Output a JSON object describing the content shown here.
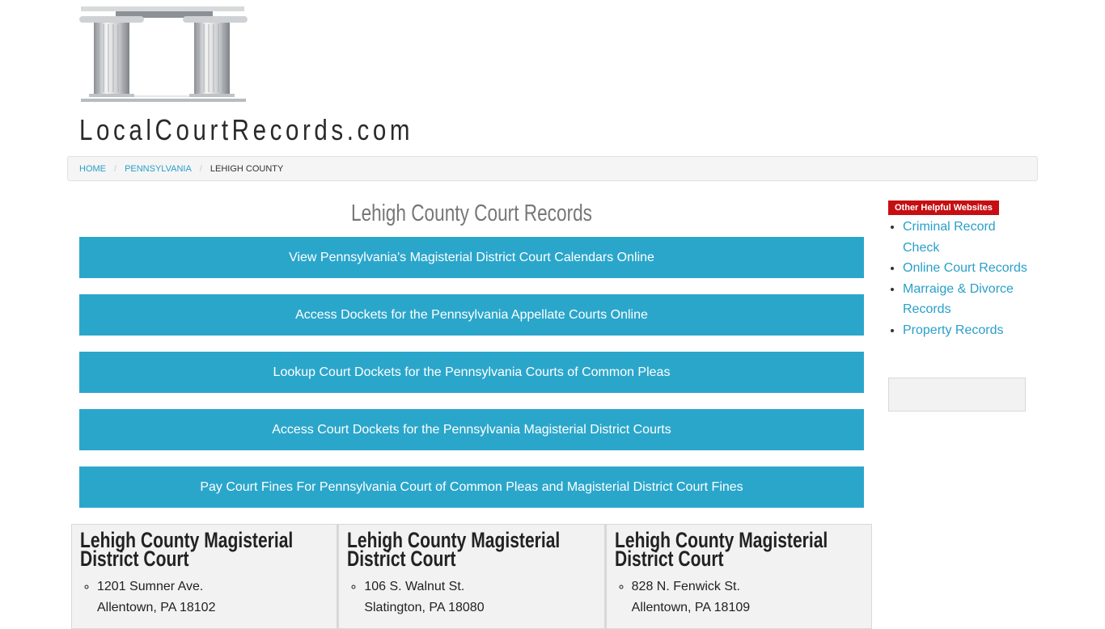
{
  "site": {
    "name": "LocalCourtRecords.com",
    "logo_alt": "courthouse-pillars-logo"
  },
  "breadcrumb": [
    {
      "label": "Home"
    },
    {
      "label": "Pennsylvania"
    },
    {
      "label": "Lehigh County"
    }
  ],
  "main": {
    "title": "Lehigh County Court Records",
    "buttons": [
      {
        "label": "View Pennsylvania's Magisterial District Court Calendars Online"
      },
      {
        "label": "Access Dockets for the Pennsylvania Appellate Courts Online"
      },
      {
        "label": "Lookup Court Dockets for the Pennsylvania Courts of Common Pleas"
      },
      {
        "label": "Access Court Dockets for the Pennsylvania Magisterial District Courts"
      },
      {
        "label": "Pay Court Fines For Pennsylvania Court of Common Pleas and Magisterial District Court Fines"
      }
    ],
    "courts": [
      {
        "name": "Lehigh County Magisterial District Court",
        "street": "1201 Sumner Ave.",
        "city": "Allentown, PA 18102"
      },
      {
        "name": "Lehigh County Magisterial District Court",
        "street": "106 S. Walnut St.",
        "city": "Slatington, PA 18080"
      },
      {
        "name": "Lehigh County Magisterial District Court",
        "street": "828 N. Fenwick St.",
        "city": "Allentown, PA 18109"
      }
    ]
  },
  "sidebar": {
    "badge": "Other Helpful Websites",
    "links": [
      {
        "label": "Criminal Record Check"
      },
      {
        "label": "Online Court Records"
      },
      {
        "label": "Marraige & Divorce Records"
      },
      {
        "label": "Property Records"
      }
    ]
  },
  "colors": {
    "accent": "#2ba6cb",
    "link": "#2a9fc9",
    "badge": "#c60f13"
  }
}
